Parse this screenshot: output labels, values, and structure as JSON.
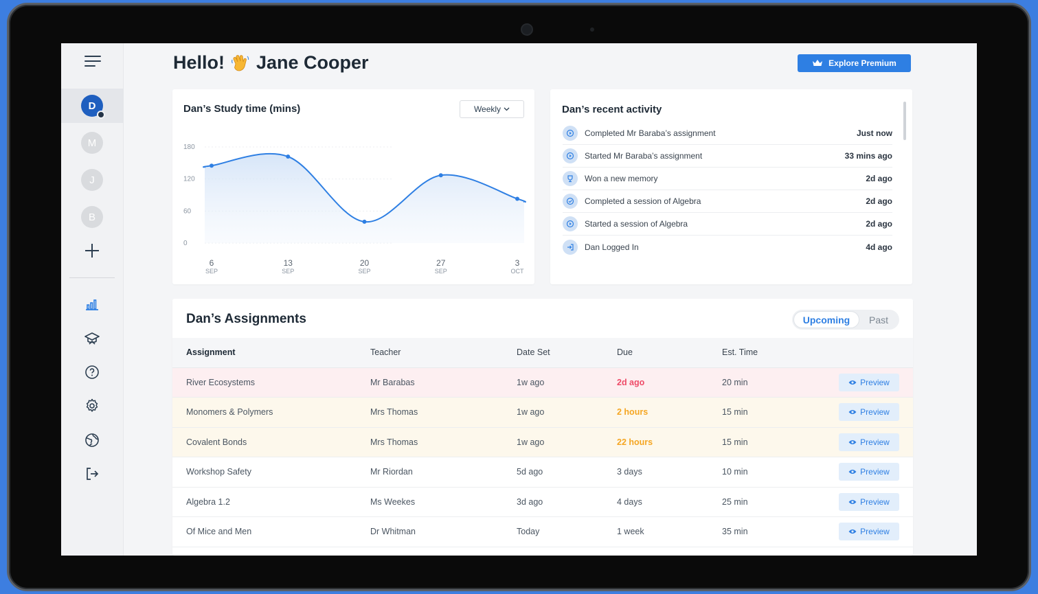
{
  "header": {
    "greeting": "Hello!",
    "wave_icon": "waving-hand-emoji",
    "name": "Jane Cooper",
    "premium_label": "Explore Premium"
  },
  "sidebar": {
    "avatars": [
      {
        "initial": "D",
        "active": true
      },
      {
        "initial": "M",
        "active": false
      },
      {
        "initial": "J",
        "active": false
      },
      {
        "initial": "B",
        "active": false
      }
    ],
    "nav_icons": [
      "bar-chart-icon",
      "graduation-cap-icon",
      "help-icon",
      "settings-icon",
      "globe-icon",
      "logout-icon"
    ]
  },
  "study": {
    "title": "Dan’s Study time (mins)",
    "range_select": "Weekly"
  },
  "activity": {
    "title": "Dan’s recent activity",
    "items": [
      {
        "text": "Completed Mr Baraba’s assignment",
        "time": "Just now",
        "icon": "play-icon"
      },
      {
        "text": "Started Mr Baraba’s assignment",
        "time": "33 mins ago",
        "icon": "play-icon"
      },
      {
        "text": "Won a new memory",
        "time": "2d ago",
        "icon": "trophy-icon"
      },
      {
        "text": "Completed a session of Algebra",
        "time": "2d ago",
        "icon": "check-icon"
      },
      {
        "text": "Started a session of Algebra",
        "time": "2d ago",
        "icon": "play-icon"
      },
      {
        "text": "Dan Logged In",
        "time": "4d ago",
        "icon": "login-icon"
      }
    ]
  },
  "assignments": {
    "title": "Dan’s Assignments",
    "tabs": [
      "Upcoming",
      "Past"
    ],
    "columns": [
      "Assignment",
      "Teacher",
      "Date Set",
      "Due",
      "Est. Time"
    ],
    "preview_label": "Preview",
    "rows": [
      {
        "assignment": "River Ecosystems",
        "teacher": "Mr Barabas",
        "date_set": "1w ago",
        "due": "2d ago",
        "est": "20 min",
        "status": "overdue"
      },
      {
        "assignment": "Monomers & Polymers",
        "teacher": "Mrs Thomas",
        "date_set": "1w ago",
        "due": "2 hours",
        "est": "15 min",
        "status": "soon"
      },
      {
        "assignment": "Covalent Bonds",
        "teacher": "Mrs Thomas",
        "date_set": "1w ago",
        "due": "22 hours",
        "est": "15 min",
        "status": "soon"
      },
      {
        "assignment": "Workshop Safety",
        "teacher": "Mr Riordan",
        "date_set": "5d ago",
        "due": "3 days",
        "est": "10 min",
        "status": "normal"
      },
      {
        "assignment": "Algebra 1.2",
        "teacher": "Ms Weekes",
        "date_set": "3d ago",
        "due": "4 days",
        "est": "25 min",
        "status": "normal"
      },
      {
        "assignment": "Of Mice and Men",
        "teacher": "Dr Whitman",
        "date_set": "Today",
        "due": "1 week",
        "est": "35 min",
        "status": "normal"
      }
    ]
  },
  "colors": {
    "accent": "#2e7fe3",
    "overdue": "#ee4b68",
    "soon": "#f5a623"
  },
  "chart_data": {
    "type": "area",
    "title": "Dan’s Study time (mins)",
    "xlabel": "",
    "ylabel": "",
    "x": [
      {
        "day": "6",
        "month": "SEP"
      },
      {
        "day": "13",
        "month": "SEP"
      },
      {
        "day": "20",
        "month": "SEP"
      },
      {
        "day": "27",
        "month": "SEP"
      },
      {
        "day": "3",
        "month": "OCT"
      }
    ],
    "y_ticks": [
      "0",
      "60",
      "120",
      "180"
    ],
    "ylim": [
      0,
      180
    ],
    "series": [
      {
        "values": [
          145,
          162,
          40,
          127,
          83
        ]
      }
    ],
    "grid": true
  }
}
